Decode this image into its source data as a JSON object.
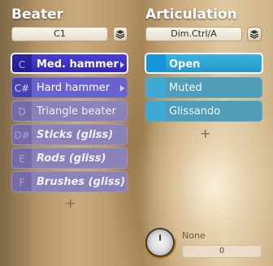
{
  "beater": {
    "title": "Beater",
    "selector_value": "C1",
    "icon": "stack-icon",
    "items": [
      {
        "key": "C",
        "label": "Med. hammer",
        "state": "selected"
      },
      {
        "key": "C#",
        "label": "Hard hammer",
        "state": "available"
      },
      {
        "key": "D",
        "label": "Triangle beater",
        "state": "dim"
      },
      {
        "key": "D#",
        "label": "Sticks (gliss)",
        "state": "dim"
      },
      {
        "key": "E",
        "label": "Rods (gliss)",
        "state": "dim"
      },
      {
        "key": "F",
        "label": "Brushes (gliss)",
        "state": "dim"
      }
    ],
    "add_label": "+"
  },
  "articulation": {
    "title": "Articulation",
    "selector_value": "Dim.Ctrl/A",
    "icon": "stack-icon",
    "items": [
      {
        "label": "Open",
        "state": "selected"
      },
      {
        "label": "Muted",
        "state": "normal"
      },
      {
        "label": "Glissando",
        "state": "normal"
      }
    ],
    "add_label": "+"
  },
  "knob": {
    "label": "None",
    "value": "0"
  },
  "colors": {
    "beater_selected": "#3c31c4",
    "beater_available": "#6a62ce",
    "beater_dim": "#8a82b8",
    "articulation_key": "#3fa8d5",
    "articulation_row": "#4f9db9",
    "knob_accent": "#d88a1f"
  }
}
